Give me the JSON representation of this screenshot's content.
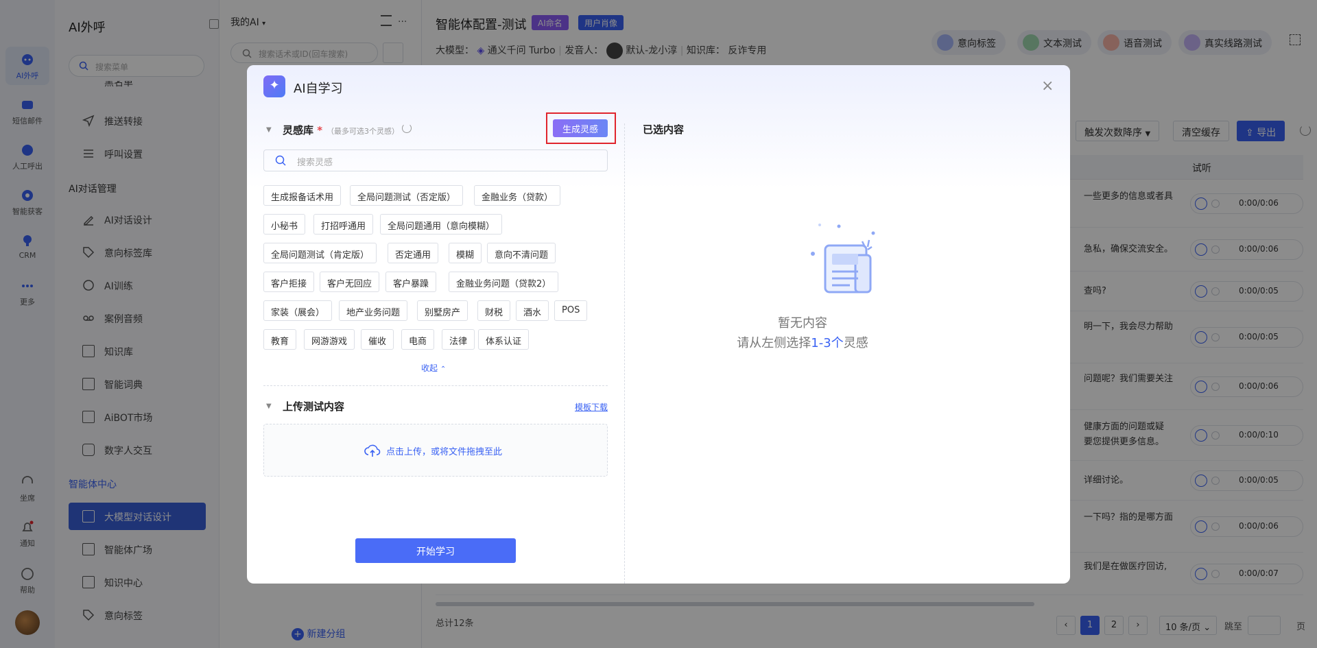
{
  "rail": {
    "items": [
      {
        "label": "AI外呼"
      },
      {
        "label": "短信邮件"
      },
      {
        "label": "人工呼出"
      },
      {
        "label": "智能获客"
      },
      {
        "label": "CRM"
      },
      {
        "label": "更多"
      }
    ],
    "bottom": [
      {
        "label": "坐席"
      },
      {
        "label": "通知"
      },
      {
        "label": "帮助"
      }
    ]
  },
  "menu": {
    "title": "AI外呼",
    "search_placeholder": "搜索菜单",
    "partial_item": "黑名单",
    "items_a": [
      {
        "label": "推送转接"
      },
      {
        "label": "呼叫设置"
      }
    ],
    "group_dialog": "AI对话管理",
    "items_b": [
      {
        "label": "AI对话设计"
      },
      {
        "label": "意向标签库"
      },
      {
        "label": "AI训练"
      },
      {
        "label": "案例音频"
      },
      {
        "label": "知识库"
      },
      {
        "label": "智能词典"
      },
      {
        "label": "AiBOT市场"
      },
      {
        "label": "数字人交互"
      }
    ],
    "group_agent": "智能体中心",
    "items_c": [
      {
        "label": "大模型对话设计"
      },
      {
        "label": "智能体广场"
      },
      {
        "label": "知识中心"
      },
      {
        "label": "意向标签"
      }
    ]
  },
  "listpanel": {
    "dropdown": "我的AI",
    "search_placeholder": "搜索话术或ID(回车搜索)",
    "new_group": "新建分组"
  },
  "main": {
    "title": "智能体配置-测试",
    "tag_ai_name": "AI命名",
    "tag_user_profile": "用户肖像",
    "model_label": "大模型：",
    "model_value": "通义千问 Turbo",
    "speaker_label": "发音人：",
    "speaker_value": "默认-龙小淳",
    "kb_label": "知识库：",
    "kb_value": "反诈专用",
    "top_buttons": [
      {
        "label": "意向标签"
      },
      {
        "label": "文本测试"
      },
      {
        "label": "语音测试"
      },
      {
        "label": "真实线路测试"
      }
    ],
    "toolbar": {
      "sort": "触发次数降序",
      "clear_cache": "清空缓存",
      "export": "导出"
    },
    "column_listen": "试听",
    "rows": [
      {
        "text": "一些更多的信息或者具",
        "time": "0:00/0:06"
      },
      {
        "text": "急私，确保交流安全。",
        "time": "0:00/0:06"
      },
      {
        "text": "查吗?",
        "time": "0:00/0:05"
      },
      {
        "text": "明一下，我会尽力帮助",
        "time": "0:00/0:05"
      },
      {
        "text": "问题呢？我们需要关注",
        "time": "0:00/0:06"
      },
      {
        "text": "健康方面的问题或疑\n要您提供更多信息。",
        "time": "0:00/0:10"
      },
      {
        "text": "详细讨论。",
        "time": "0:00/0:05"
      },
      {
        "text": "一下吗？指的是哪方面",
        "time": "0:00/0:06"
      },
      {
        "text": "我们是在做医疗回访,",
        "time": "0:00/0:07"
      }
    ],
    "total": "总计12条",
    "pages": [
      "1",
      "2"
    ],
    "page_size": "10 条/页",
    "jump_label": "跳至",
    "page_suffix": "页"
  },
  "modal": {
    "title": "AI自学习",
    "inspiration_title": "灵感库",
    "required_mark": "*",
    "inspiration_hint": "（最多可选3个灵感）",
    "generate_button": "生成灵感",
    "search_placeholder": "搜索灵感",
    "chips": [
      "生成报备话术用",
      "全局问题测试（否定版）",
      "金融业务（贷款）",
      "小秘书",
      "打招呼通用",
      "全局问题通用（意向模糊）",
      "全局问题测试（肯定版）",
      "否定通用",
      "模糊",
      "意向不清问题",
      "客户拒接",
      "客户无回应",
      "客户暴躁",
      "金融业务问题（贷款2）",
      "家装（展会）",
      "地产业务问题",
      "别墅房产",
      "财税",
      "酒水",
      "POS",
      "教育",
      "网游游戏",
      "催收",
      "电商",
      "法律",
      "体系认证"
    ],
    "collapse": "收起",
    "upload_title": "上传测试内容",
    "template_download": "模板下载",
    "upload_text": "点击上传，或将文件拖拽至此",
    "start_button": "开始学习",
    "selected_title": "已选内容",
    "empty_text": "暂无内容",
    "empty_hint_prefix": "请从左侧选择",
    "empty_hint_highlight": "1-3个",
    "empty_hint_suffix": "灵感"
  }
}
